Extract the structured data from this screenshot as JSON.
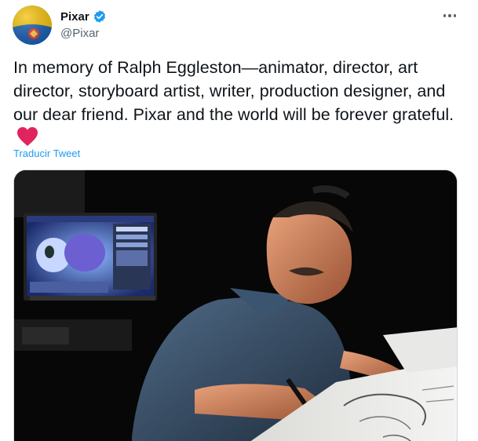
{
  "tweet": {
    "author": {
      "display_name": "Pixar",
      "handle": "@Pixar",
      "verified": true,
      "avatar_icon": "pixar-ball-avatar"
    },
    "more_icon": "more-dots-icon",
    "text": "In memory of Ralph Eggleston—animator, director, art director, storyboard artist, writer, production designer, and our dear friend. Pixar and the world will be forever grateful.",
    "emoji": "red-heart",
    "translate_label": "Traducir Tweet",
    "media": {
      "type": "photo",
      "subject": "man-drawing-at-desk"
    }
  },
  "colors": {
    "link": "#1d9bf0",
    "verified": "#1d9bf0",
    "heart": "#e0245e",
    "secondary_text": "#536471"
  }
}
